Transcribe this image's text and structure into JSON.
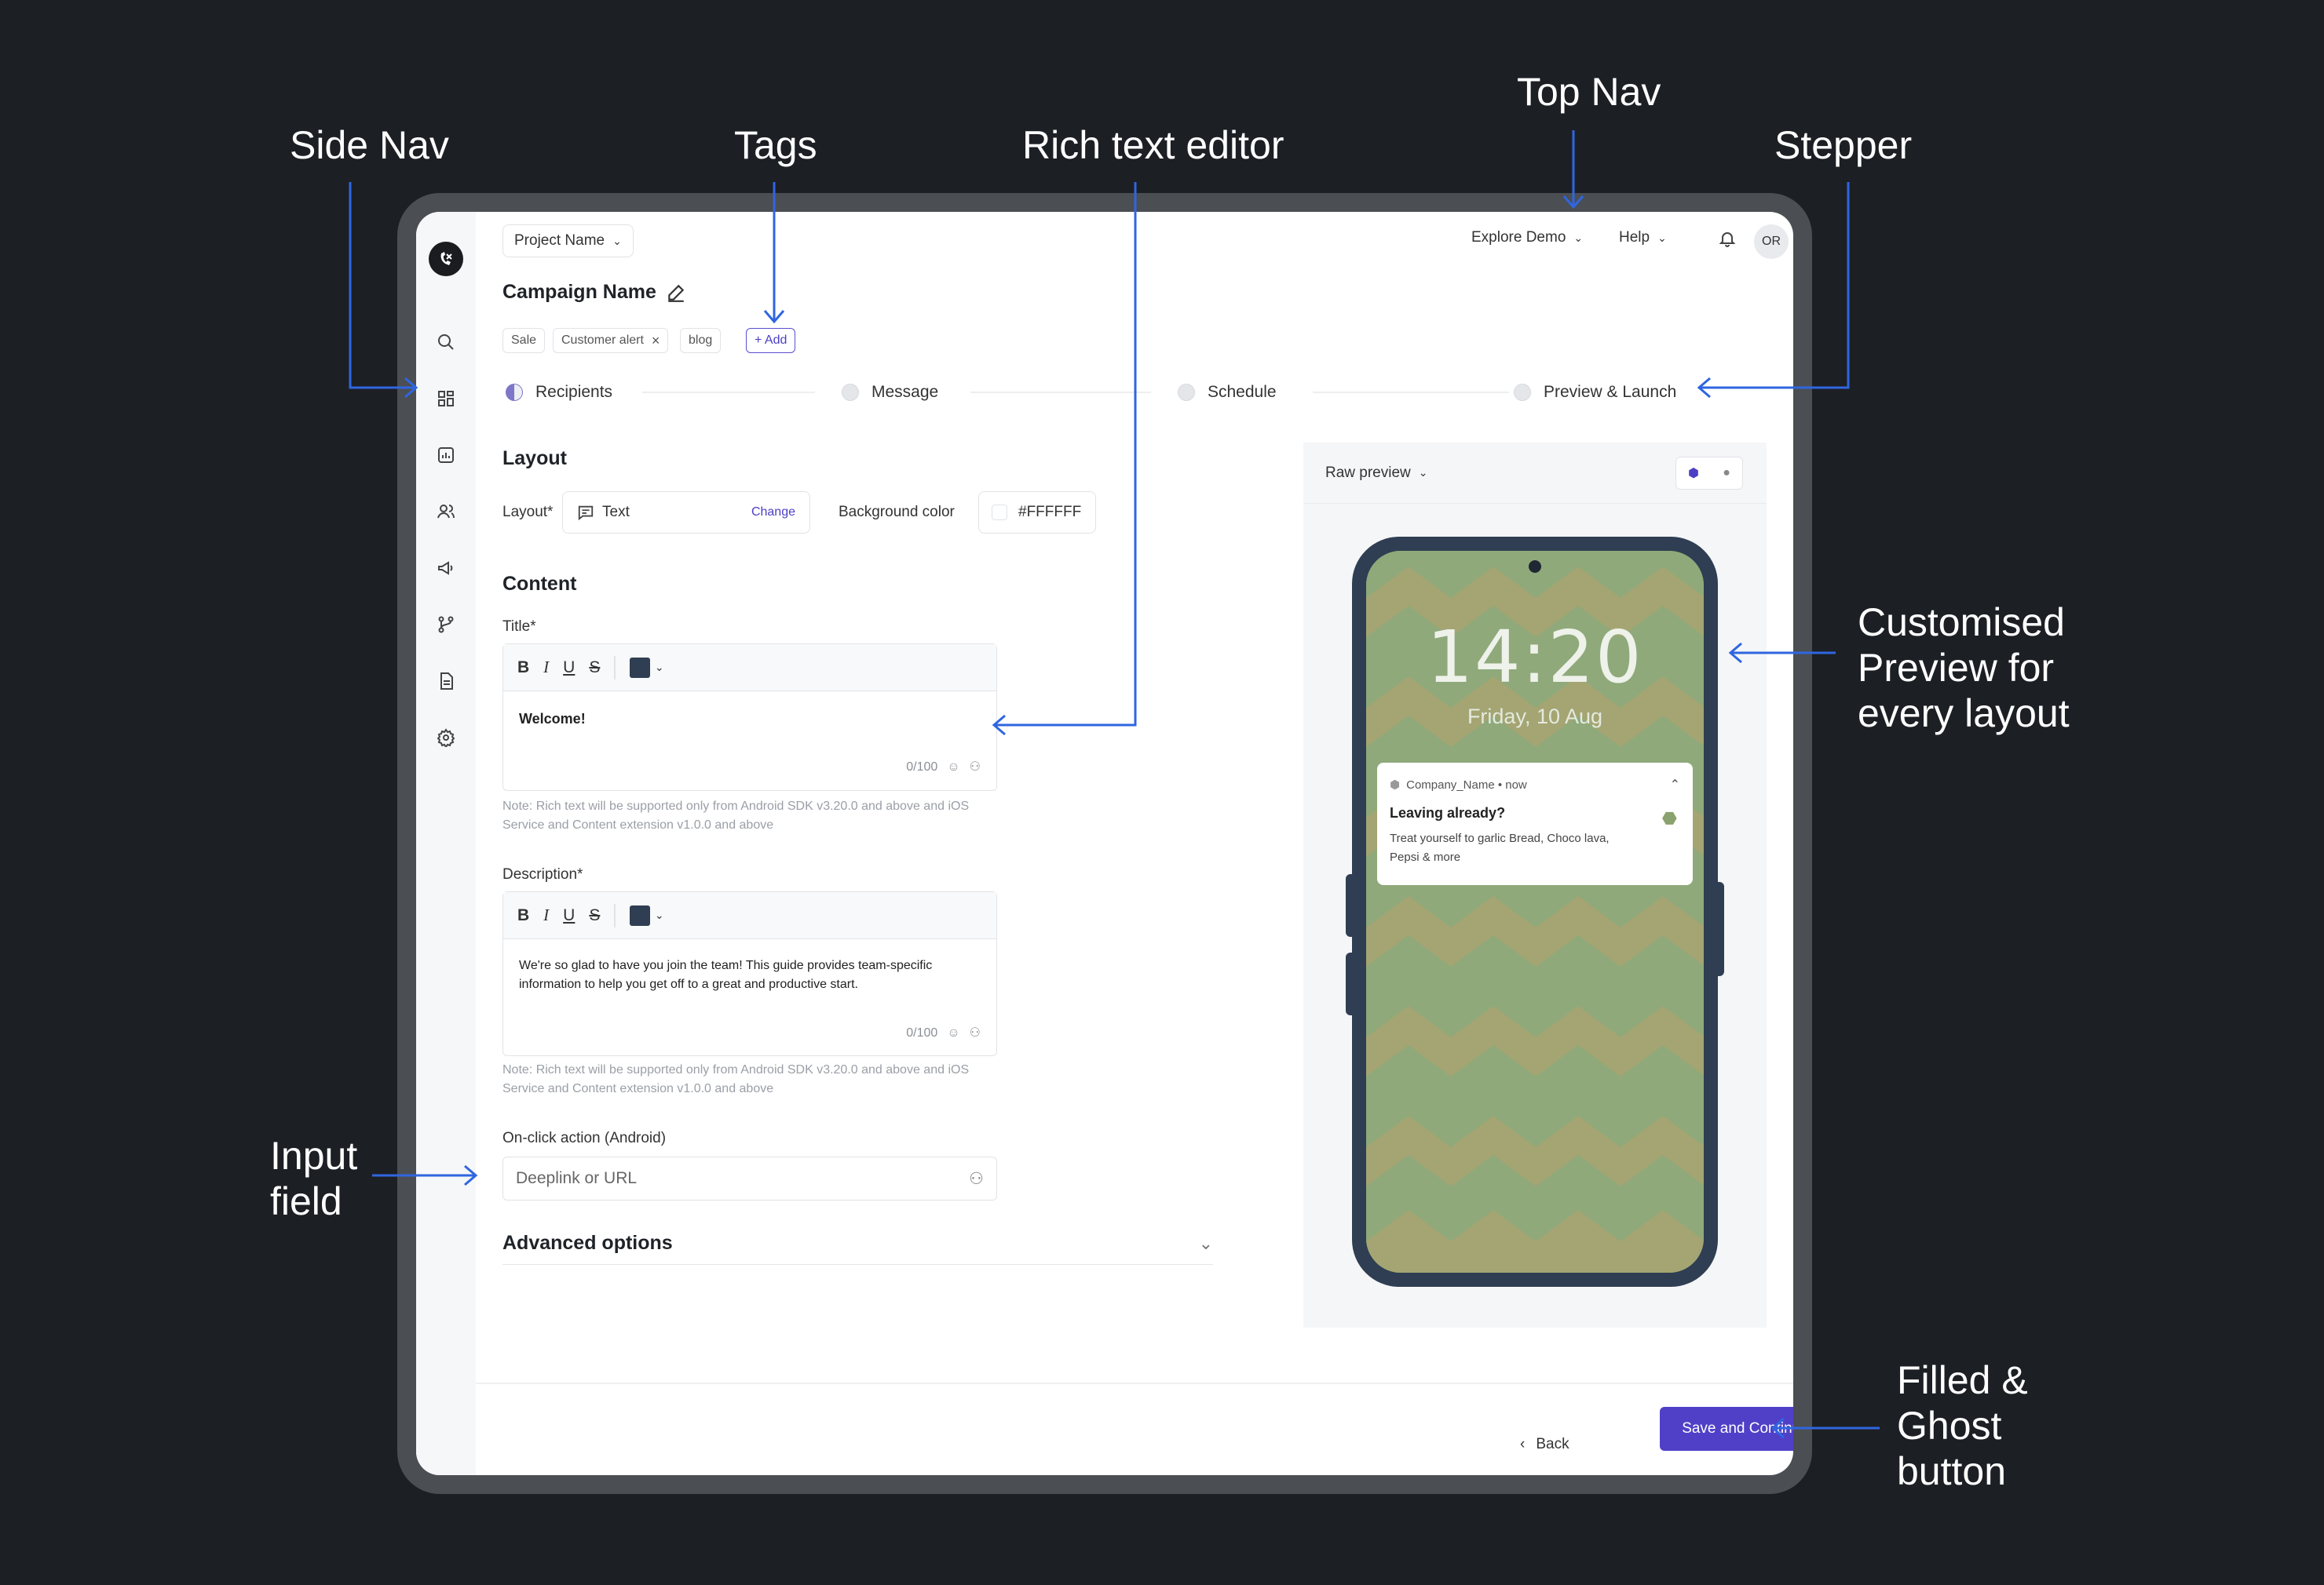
{
  "annotations": {
    "side_nav": "Side Nav",
    "tags": "Tags",
    "rich_text_editor": "Rich text editor",
    "top_nav": "Top Nav",
    "stepper": "Stepper",
    "preview_line1": "Customised",
    "preview_line2": "Preview for",
    "preview_line3": "every layout",
    "input_line1": "Input",
    "input_line2": "field",
    "button_line1": "Filled &",
    "button_line2": "Ghost",
    "button_line3": "button"
  },
  "colors": {
    "accent": "#5040c8",
    "swatch": "#2f3e52",
    "phone_body": "#2f3e52",
    "wallpaper_a": "#8fa97a",
    "wallpaper_b": "#a4a572"
  },
  "topbar": {
    "project": "Project Name",
    "explore": "Explore Demo",
    "help": "Help",
    "avatar": "OR"
  },
  "campaign": {
    "name": "Campaign Name",
    "tags": [
      "Sale",
      "Customer alert",
      "blog"
    ],
    "add_tag": "+ Add"
  },
  "stepper": [
    "Recipients",
    "Message",
    "Schedule",
    "Preview & Launch"
  ],
  "layout": {
    "heading": "Layout",
    "layout_label": "Layout*",
    "layout_value": "Text",
    "change": "Change",
    "bg_label": "Background color",
    "bg_value": "#FFFFFF"
  },
  "content": {
    "heading": "Content",
    "title_label": "Title*",
    "title_value": "Welcome!",
    "title_count": "0/100",
    "desc_label": "Description*",
    "desc_value": "We're so glad to have you join the team! This guide provides team-specific information to help you get off to a great and productive start.",
    "desc_count": "0/100",
    "note1": "Note: Rich text will be supported only from Android SDK v3.20.0 and above and iOS Service and Content extension v1.0.0 and above",
    "note2": "Note: Rich text will be supported only from Android SDK v3.20.0 and above and iOS Service and Content extension v1.0.0 and above",
    "onclick_label": "On-click action (Android)",
    "onclick_placeholder": "Deeplink or URL",
    "advanced": "Advanced options"
  },
  "preview": {
    "mode": "Raw preview",
    "time": "14:20",
    "date": "Friday, 10 Aug",
    "app": "Company_Name • now",
    "notif_title": "Leaving already?",
    "notif_body": "Treat yourself to garlic Bread, Choco lava, Pepsi & more"
  },
  "footer": {
    "back": "Back",
    "save": "Save and Continue"
  },
  "icons": {
    "logo": "brand-logo-icon",
    "nav": [
      "search-icon",
      "dashboard-icon",
      "analytics-icon",
      "users-icon",
      "megaphone-icon",
      "journey-icon",
      "document-icon",
      "settings-icon"
    ]
  }
}
